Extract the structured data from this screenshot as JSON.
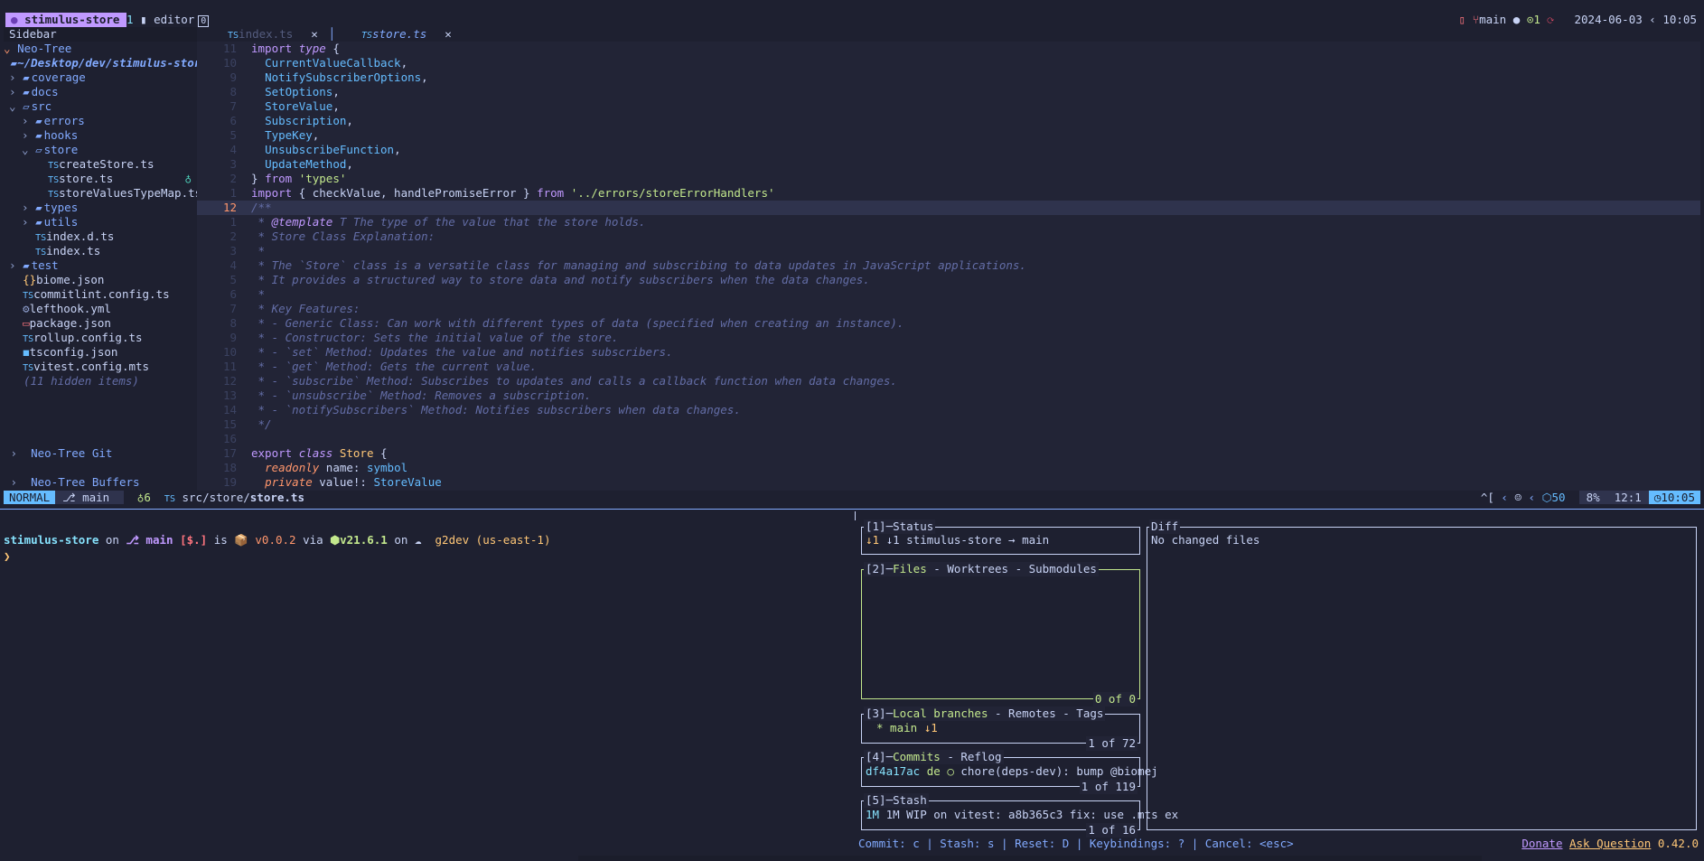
{
  "tmux": {
    "session": "stimulus-store",
    "window": "editor",
    "window_box": "0",
    "branch": "main",
    "prs": "1",
    "date": "2024-06-03",
    "time": "10:05"
  },
  "sidebar": {
    "title": "Sidebar",
    "neotree": "Neo-Tree",
    "root": "~/Desktop/dev/stimulus-stor",
    "items": [
      {
        "label": "coverage",
        "kind": "dir",
        "depth": 1
      },
      {
        "label": "docs",
        "kind": "dir",
        "depth": 1
      },
      {
        "label": "src",
        "kind": "dir-open",
        "depth": 1
      },
      {
        "label": "errors",
        "kind": "dir",
        "depth": 2
      },
      {
        "label": "hooks",
        "kind": "dir",
        "depth": 2
      },
      {
        "label": "store",
        "kind": "dir-open",
        "depth": 2
      },
      {
        "label": "createStore.ts",
        "kind": "ts",
        "depth": 3
      },
      {
        "label": "store.ts",
        "kind": "ts",
        "depth": 3
      },
      {
        "label": "storeValuesTypeMap.ts",
        "kind": "ts",
        "depth": 3
      },
      {
        "label": "types",
        "kind": "dir",
        "depth": 2
      },
      {
        "label": "utils",
        "kind": "dir",
        "depth": 2
      },
      {
        "label": "index.d.ts",
        "kind": "ts",
        "depth": 2
      },
      {
        "label": "index.ts",
        "kind": "ts",
        "depth": 2
      },
      {
        "label": "test",
        "kind": "dir",
        "depth": 1
      },
      {
        "label": "biome.json",
        "kind": "json",
        "depth": 1
      },
      {
        "label": "commitlint.config.ts",
        "kind": "ts",
        "depth": 1
      },
      {
        "label": "lefthook.yml",
        "kind": "yml",
        "depth": 1
      },
      {
        "label": "package.json",
        "kind": "pkg",
        "depth": 1
      },
      {
        "label": "rollup.config.ts",
        "kind": "ts",
        "depth": 1
      },
      {
        "label": "tsconfig.json",
        "kind": "tsc",
        "depth": 1
      },
      {
        "label": "vitest.config.mts",
        "kind": "ts",
        "depth": 1
      }
    ],
    "hidden": "(11 hidden items)",
    "git_section": "Neo-Tree Git",
    "buffers_section": "Neo-Tree Buffers"
  },
  "tabs": [
    {
      "label": "index.ts",
      "active": false
    },
    {
      "label": "store.ts",
      "active": true
    }
  ],
  "code_lines": [
    {
      "n": "11",
      "html": "<span class='kw2'>import</span> <span class='kw'>type</span> {"
    },
    {
      "n": "10",
      "html": "  <span class='id'>CurrentValueCallback</span>,"
    },
    {
      "n": "9",
      "html": "  <span class='id'>NotifySubscriberOptions</span>,"
    },
    {
      "n": "8",
      "html": "  <span class='id'>SetOptions</span>,"
    },
    {
      "n": "7",
      "html": "  <span class='id'>StoreValue</span>,"
    },
    {
      "n": "6",
      "html": "  <span class='id'>Subscription</span>,"
    },
    {
      "n": "5",
      "html": "  <span class='id'>TypeKey</span>,"
    },
    {
      "n": "4",
      "html": "  <span class='id'>UnsubscribeFunction</span>,"
    },
    {
      "n": "3",
      "html": "  <span class='id'>UpdateMethod</span>,"
    },
    {
      "n": "2",
      "html": "} <span class='kw2'>from</span> <span class='str'>'types'</span>"
    },
    {
      "n": "1",
      "html": "<span class='kw2'>import</span> { checkValue, handlePromiseError } <span class='kw2'>from</span> <span class='str'>'../errors/storeErrorHandlers'</span>"
    },
    {
      "n": "12",
      "cur": true,
      "html": "<span class='cm'>/**</span>"
    },
    {
      "n": "1",
      "html": "<span class='cm'> * </span><span class='tag'>@template</span><span class='cm'> T The type of the value that the store holds.</span>"
    },
    {
      "n": "2",
      "html": "<span class='cm'> * Store Class Explanation:</span>"
    },
    {
      "n": "3",
      "html": "<span class='cm'> *</span>"
    },
    {
      "n": "4",
      "html": "<span class='cm'> * The `Store` class is a versatile class for managing and subscribing to data updates in JavaScript applications.</span>"
    },
    {
      "n": "5",
      "html": "<span class='cm'> * It provides a structured way to store data and notify subscribers when the data changes.</span>"
    },
    {
      "n": "6",
      "html": "<span class='cm'> *</span>"
    },
    {
      "n": "7",
      "html": "<span class='cm'> * Key Features:</span>"
    },
    {
      "n": "8",
      "html": "<span class='cm'> * - Generic Class: Can work with different types of data (specified when creating an instance).</span>"
    },
    {
      "n": "9",
      "html": "<span class='cm'> * - Constructor: Sets the initial value of the store.</span>"
    },
    {
      "n": "10",
      "html": "<span class='cm'> * - `set` Method: Updates the value and notifies subscribers.</span>"
    },
    {
      "n": "11",
      "html": "<span class='cm'> * - `get` Method: Gets the current value.</span>"
    },
    {
      "n": "12",
      "html": "<span class='cm'> * - `subscribe` Method: Subscribes to updates and calls a callback function when data changes.</span>"
    },
    {
      "n": "13",
      "html": "<span class='cm'> * - `unsubscribe` Method: Removes a subscription.</span>"
    },
    {
      "n": "14",
      "html": "<span class='cm'> * - `notifySubscribers` Method: Notifies subscribers when data changes.</span>"
    },
    {
      "n": "15",
      "html": "<span class='cm'> */</span>"
    },
    {
      "n": "16",
      "html": ""
    },
    {
      "n": "17",
      "html": "<span class='kw2'>export</span> <span class='kw'>class</span> <span class='cls'>Store</span> {"
    },
    {
      "n": "18",
      "html": "  <span class='prop'>readonly</span> name: <span class='typ'>symbol</span>"
    },
    {
      "n": "19",
      "html": "  <span class='prop'>private</span> value!: <span class='typ'>StoreValue</span>"
    }
  ],
  "statusline": {
    "mode": "NORMAL",
    "branch": "main",
    "diag": "6",
    "path_prefix": "src/store/",
    "path_file": "store.ts",
    "keys": "^[",
    "count": "50",
    "percent": "8%",
    "position": "12:1",
    "clock": "10:05"
  },
  "terminal": {
    "dir": "stimulus-store",
    "on": "on",
    "branch": "main",
    "status": "[$.]",
    "is": "is",
    "pkg_version": "v0.0.2",
    "via": "via",
    "node_version": "v21.6.1",
    "on2": "on",
    "aws": "g2dev (us-east-1)",
    "prompt": "❯"
  },
  "lazygit": {
    "status_title": "[1]─Status",
    "status_text": "↓1 stimulus-store → main",
    "files_title_num": "[2]─",
    "files_title": "Files",
    "files_rest": " - Worktrees - Submodules",
    "files_count": "0 of 0",
    "branches_num": "[3]─",
    "branches_title": "Local branches",
    "branches_rest": " - Remotes - Tags",
    "branch_item": "* main ↓1",
    "branches_count": "1 of 72",
    "commits_num": "[4]─",
    "commits_title": "Commits",
    "commits_rest": " - Reflog",
    "commit_hash": "df4a17ac",
    "commit_author": "de",
    "commit_msg": "chore(deps-dev): bump @biomej",
    "commits_count": "1 of 119",
    "stash_title": "[5]─Stash",
    "stash_item": "1M WIP on vitest: a8b365c3 fix: use .mts ex",
    "stash_count": "1 of 16",
    "diff_title": "Diff",
    "diff_text": "No changed files",
    "footer": "Commit: c | Stash: s | Reset: D | Keybindings: ? | Cancel: <esc>",
    "donate": "Donate",
    "ask": "Ask Question",
    "version": "0.42.0"
  }
}
